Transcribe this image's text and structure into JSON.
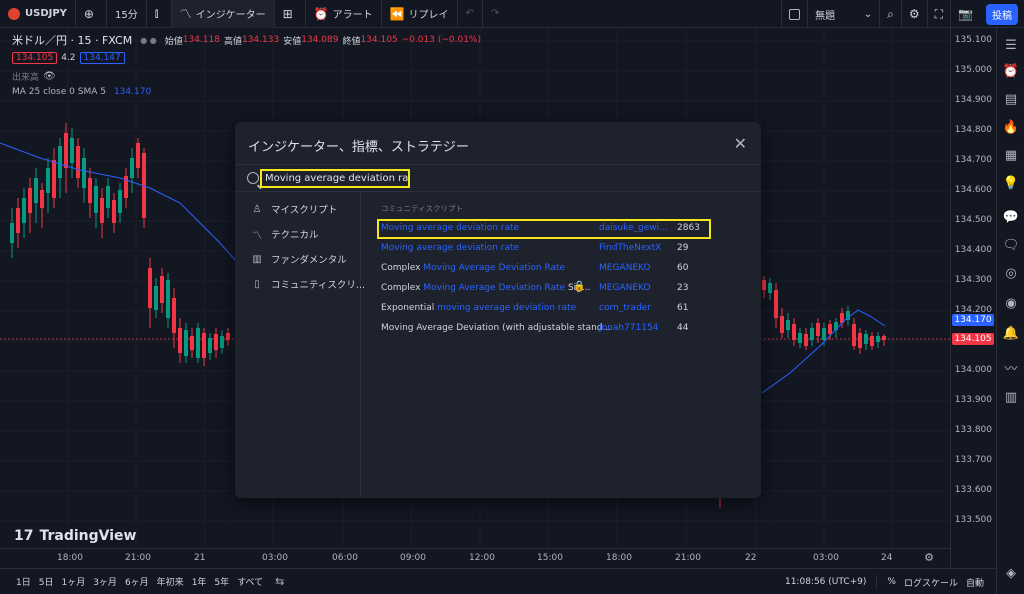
{
  "toolbar": {
    "symbol": "USDJPY",
    "interval": "15分",
    "indicators_label": "インジケーター",
    "alert_label": "アラート",
    "replay_label": "リプレイ",
    "untitled_label": "無題",
    "post_button": "投稿"
  },
  "legend": {
    "instrument": "米ドル／円 · 15 · FXCM",
    "open_label": "始値",
    "open_value": "134.118",
    "high_label": "高値",
    "high_value": "134.133",
    "low_label": "安値",
    "low_value": "134.089",
    "close_label": "終値",
    "close_value": "134.105",
    "change": "−0.013 (−0.01%)",
    "bid": "134.105",
    "spread": "4.2",
    "ask": "134.147",
    "volume_label": "出来高",
    "ma_label": "MA 25 close 0 SMA 5",
    "ma_value": "134.170"
  },
  "price_axis": {
    "labels": [
      "135.100",
      "135.000",
      "134.900",
      "134.800",
      "134.700",
      "134.600",
      "134.500",
      "134.400",
      "134.300",
      "134.200",
      "134.000",
      "133.900",
      "133.800",
      "133.700",
      "133.600",
      "133.500"
    ],
    "ma_tag": "134.170",
    "last_tag": "134.105"
  },
  "time_axis": {
    "labels": [
      "18:00",
      "21:00",
      "21",
      "03:00",
      "06:00",
      "09:00",
      "12:00",
      "15:00",
      "18:00",
      "21:00",
      "22",
      "03:00",
      "24"
    ]
  },
  "bottom_bar": {
    "ranges": [
      "1日",
      "5日",
      "1ヶ月",
      "3ヶ月",
      "6ヶ月",
      "年初来",
      "1年",
      "5年",
      "すべて"
    ],
    "clock": "11:08:56 (UTC+9)",
    "percent": "%",
    "log": "ログスケール",
    "auto": "自動"
  },
  "watermark": "TradingView",
  "dialog": {
    "title": "インジケーター、指標、ストラテジー",
    "search_value": "Moving average deviation rate",
    "sidebar": [
      {
        "label": "マイスクリプト",
        "icon": "user-icon"
      },
      {
        "label": "テクニカル",
        "icon": "chart-icon"
      },
      {
        "label": "ファンダメンタル",
        "icon": "bar-chart-icon"
      },
      {
        "label": "コミュニティスクリ...",
        "icon": "bookmark-icon"
      }
    ],
    "section_header": "コミュニティスクリプト",
    "results": [
      {
        "prefix": "",
        "highlight": "Moving average deviation rate",
        "suffix": "",
        "author": "daisuke_gewi...",
        "count": "2863",
        "locked": false
      },
      {
        "prefix": "",
        "highlight": "Moving average deviation rate",
        "suffix": "",
        "author": "FindTheNextX",
        "count": "29",
        "locked": false
      },
      {
        "prefix": "Complex ",
        "highlight": "Moving Average Deviation Rate",
        "suffix": "",
        "author": "MEGANEKO",
        "count": "60",
        "locked": false
      },
      {
        "prefix": "Complex ",
        "highlight": "Moving Average Deviation Rate",
        "suffix": " Sig...",
        "author": "MEGANEKO",
        "count": "23",
        "locked": true
      },
      {
        "prefix": "Exponential ",
        "highlight": "moving average deviation rate",
        "suffix": "",
        "author": "corn_trader",
        "count": "61",
        "locked": false
      },
      {
        "prefix": "Moving Average Deviation (with adjustable stand...",
        "highlight": "",
        "suffix": "",
        "author": "Jonah771154",
        "count": "44",
        "locked": false
      }
    ]
  },
  "colors": {
    "up": "#089981",
    "down": "#f23645",
    "ma": "#2962ff",
    "highlight": "#f4e916"
  }
}
